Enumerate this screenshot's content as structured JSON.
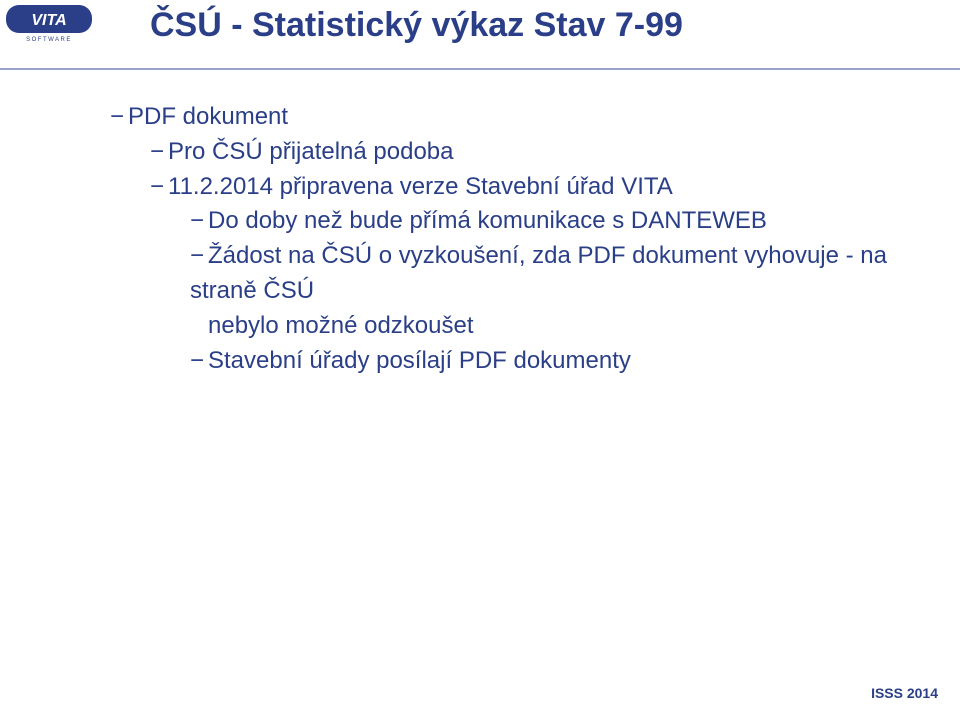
{
  "header": {
    "logo_brand": "VITA",
    "logo_sub": "SOFTWARE",
    "title": "ČSÚ - Statistický výkaz Stav 7-99"
  },
  "bullets": {
    "l1a": "PDF dokument",
    "l2a": "Pro ČSÚ přijatelná podoba",
    "l2b": "11.2.2014 připravena verze Stavební úřad VITA",
    "l3a": "Do doby než bude přímá komunikace s DANTEWEB",
    "l3b": "Žádost na ČSÚ o vyzkoušení, zda PDF dokument vyhovuje - na straně ČSÚ",
    "l3b_cont": "nebylo možné odzkoušet",
    "l3c": "Stavební úřady posílají PDF dokumenty"
  },
  "footer": {
    "text": "ISSS 2014"
  }
}
